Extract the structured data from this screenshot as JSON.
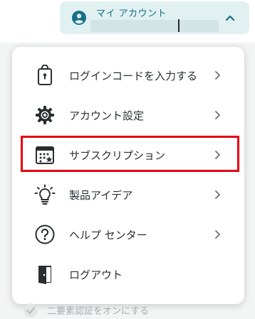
{
  "account": {
    "label": "マイ アカウント",
    "avatar_icon": "user-circle-icon",
    "toggle_icon": "chevron-up-icon"
  },
  "menu": {
    "items": [
      {
        "label": "ログインコードを入力する",
        "icon": "phone-lock-icon",
        "has_chevron": true
      },
      {
        "label": "アカウント設定",
        "icon": "gear-icon",
        "has_chevron": true
      },
      {
        "label": "サブスクリプション",
        "icon": "calendar-icon",
        "has_chevron": true,
        "highlighted": true
      },
      {
        "label": "製品アイデア",
        "icon": "lightbulb-icon",
        "has_chevron": true
      },
      {
        "label": "ヘルプ センター",
        "icon": "question-circle-icon",
        "has_chevron": true
      },
      {
        "label": "ログアウト",
        "icon": "logout-door-icon",
        "has_chevron": false
      }
    ]
  },
  "background_option": {
    "label": "二要素認証をオンにする",
    "icon": "check-icon"
  },
  "colors": {
    "accent": "#156f86",
    "pill_bg": "#e1f1f2",
    "highlight": "#e60012",
    "text": "#2a2e31"
  }
}
